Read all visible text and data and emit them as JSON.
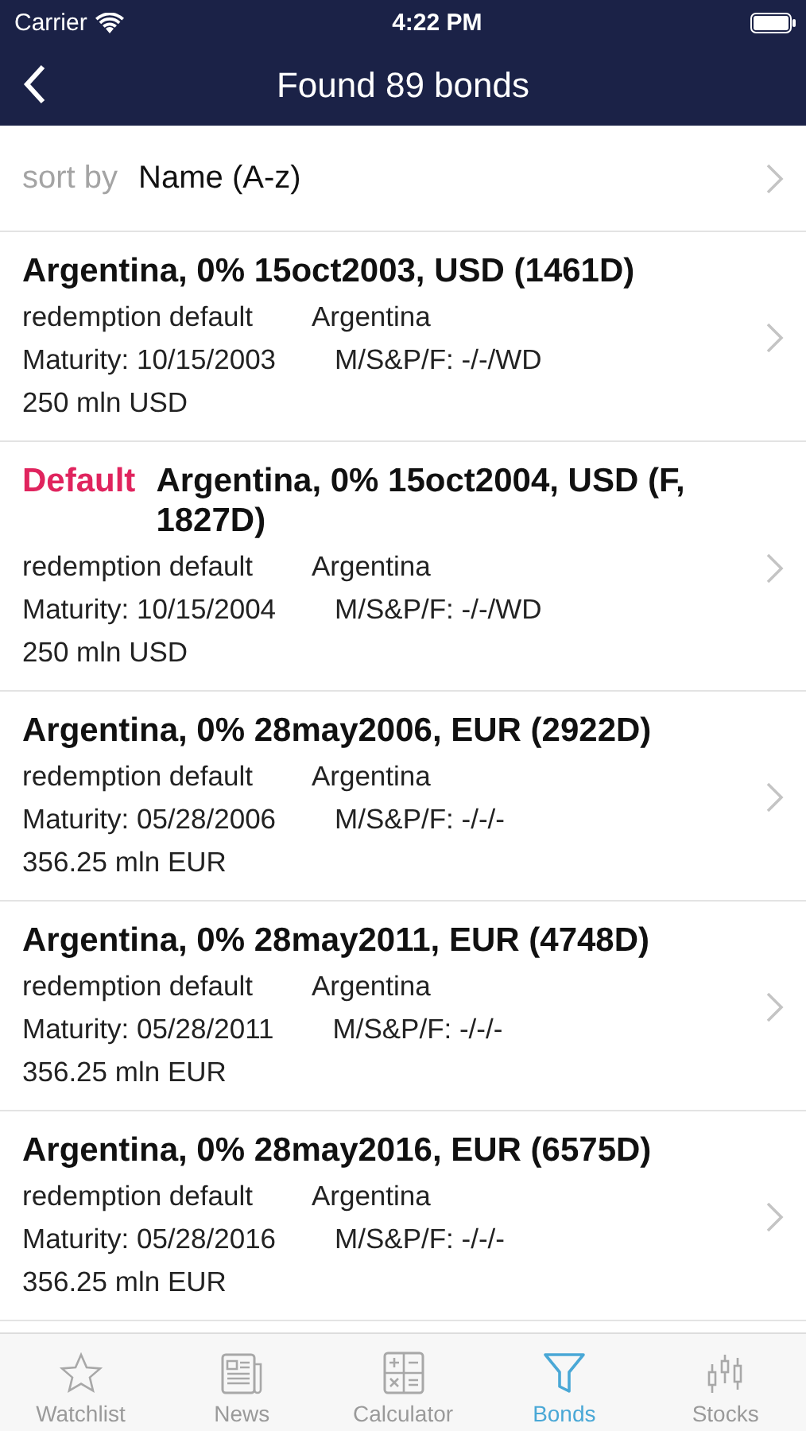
{
  "status_bar": {
    "carrier": "Carrier",
    "time": "4:22 PM"
  },
  "nav": {
    "title": "Found 89 bonds"
  },
  "sort": {
    "label": "sort by",
    "value": "Name (A-z)"
  },
  "bonds": [
    {
      "default": false,
      "title": "Argentina, 0% 15oct2003, USD (1461D)",
      "type": "redemption default",
      "country": "Argentina",
      "maturity": "Maturity: 10/15/2003",
      "ratings": "M/S&P/F: -/-/WD",
      "volume": "250 mln USD"
    },
    {
      "default": true,
      "badge": "Default",
      "title": "Argentina, 0% 15oct2004, USD (F, 1827D)",
      "type": "redemption default",
      "country": "Argentina",
      "maturity": "Maturity: 10/15/2004",
      "ratings": "M/S&P/F: -/-/WD",
      "volume": "250 mln USD"
    },
    {
      "default": false,
      "title": "Argentina, 0% 28may2006, EUR (2922D)",
      "type": "redemption default",
      "country": "Argentina",
      "maturity": "Maturity: 05/28/2006",
      "ratings": "M/S&P/F: -/-/-",
      "volume": "356.25 mln EUR"
    },
    {
      "default": false,
      "title": "Argentina, 0% 28may2011, EUR (4748D)",
      "type": "redemption default",
      "country": "Argentina",
      "maturity": "Maturity: 05/28/2011",
      "ratings": "M/S&P/F: -/-/-",
      "volume": "356.25 mln EUR"
    },
    {
      "default": false,
      "title": "Argentina, 0% 28may2016, EUR (6575D)",
      "type": "redemption default",
      "country": "Argentina",
      "maturity": "Maturity: 05/28/2016",
      "ratings": "M/S&P/F: -/-/-",
      "volume": "356.25 mln EUR"
    }
  ],
  "tab_bar": [
    {
      "label": "Watchlist",
      "selected": false
    },
    {
      "label": "News",
      "selected": false
    },
    {
      "label": "Calculator",
      "selected": false
    },
    {
      "label": "Bonds",
      "selected": true
    },
    {
      "label": "Stocks",
      "selected": false
    }
  ]
}
